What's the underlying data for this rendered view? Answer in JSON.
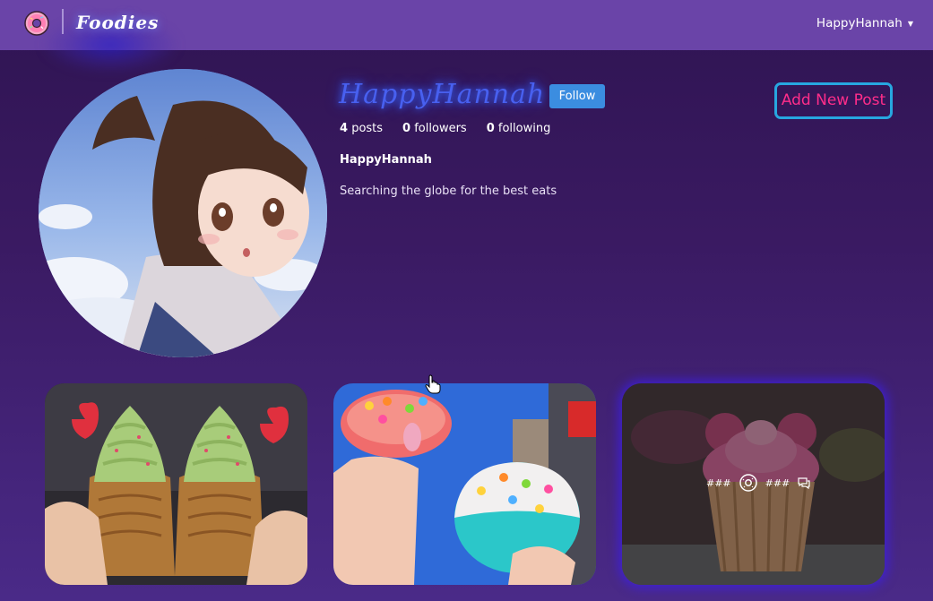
{
  "navbar": {
    "brand_name": "Foodies",
    "brand_icon": "donut-icon",
    "user_menu_label": "HappyHannah"
  },
  "profile": {
    "username": "HappyHannah",
    "follow_label": "Follow",
    "posts_count": "4",
    "posts_label": "posts",
    "followers_count": "0",
    "followers_label": "followers",
    "following_count": "0",
    "following_label": "following",
    "display_name": "HappyHannah",
    "bio": "Searching the globe for the best eats",
    "add_post_label": "Add New Post"
  },
  "posts": [
    {
      "image": "matcha soft-serve taiyaki cones"
    },
    {
      "image": "colorful cereal-topped cookies"
    },
    {
      "image": "pink frosted mouse-ear cupcake",
      "likes": "###",
      "comments": "###"
    }
  ],
  "colors": {
    "navbar_bg": "#6a44a8",
    "page_bg": "#3a1a62",
    "follow_button": "#3b8de0",
    "add_post_border": "#27a7e0",
    "add_post_text": "#ff2d8a",
    "username_glow": "#3a6cff"
  }
}
